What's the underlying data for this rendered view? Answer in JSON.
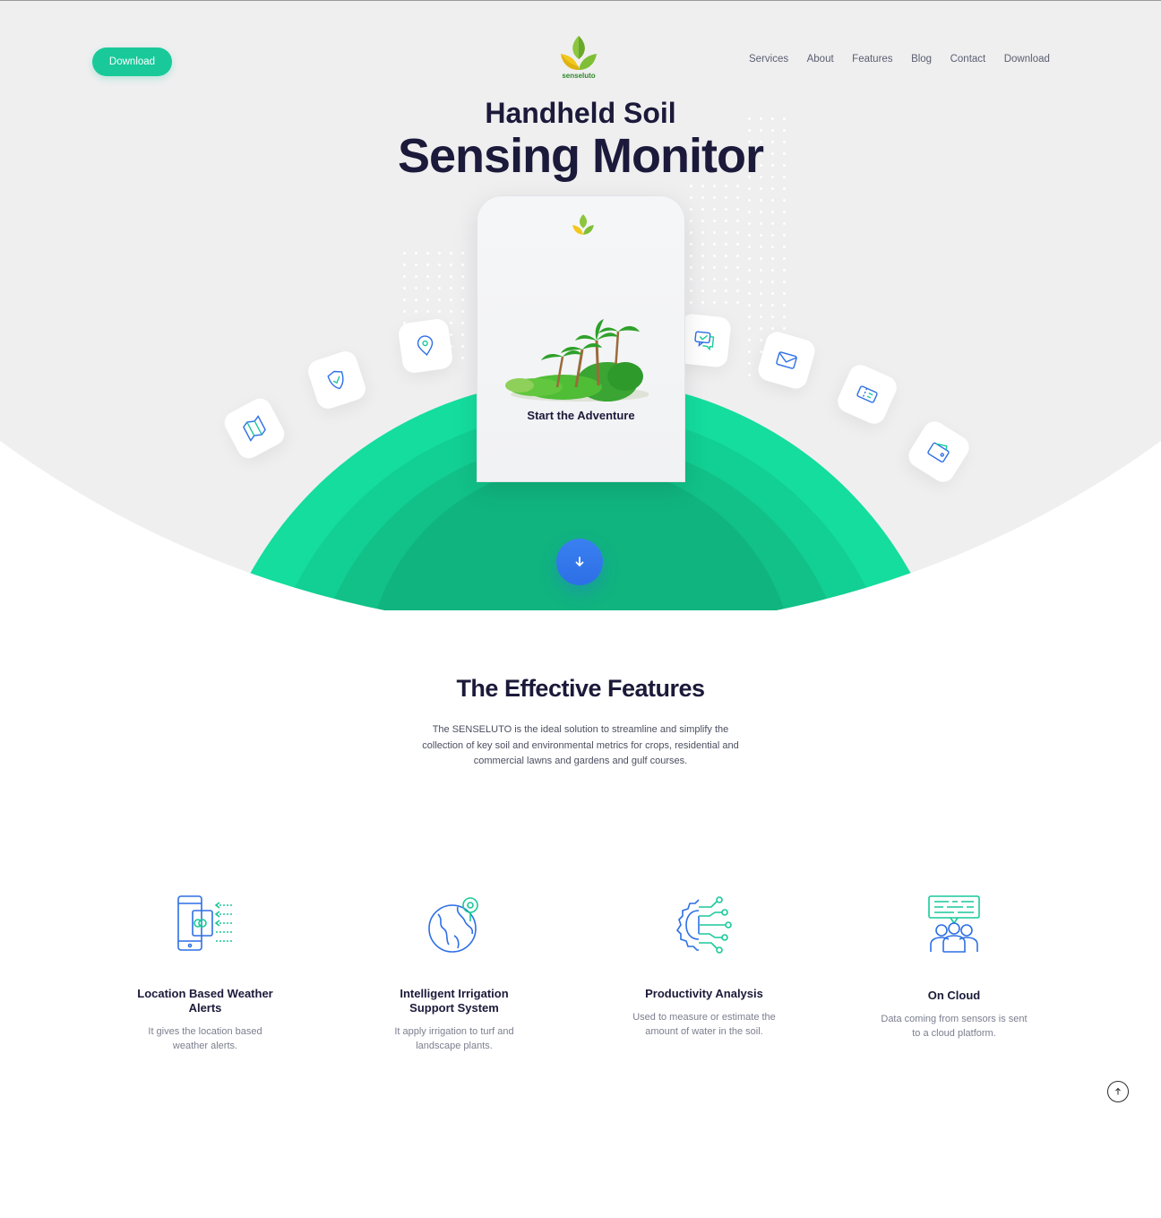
{
  "header": {
    "download_button": "Download",
    "logo_text": "senseluto",
    "nav": [
      "Services",
      "About",
      "Features",
      "Blog",
      "Contact",
      "Download"
    ]
  },
  "hero": {
    "title_line1": "Handheld Soil",
    "title_line2": "Sensing Monitor",
    "phone_caption": "Start the Adventure"
  },
  "features": {
    "title": "The Effective Features",
    "description": "The SENSELUTO is the ideal solution to streamline and simplify the collection of key soil and environmental metrics for crops, residential and commercial lawns and gardens and gulf courses.",
    "items": [
      {
        "name": "Location Based Weather Alerts",
        "desc": "It gives the location based weather alerts.",
        "icon": "mobile-alert-icon"
      },
      {
        "name": "Intelligent Irrigation Support System",
        "desc": "It apply irrigation to turf and landscape plants.",
        "icon": "globe-pin-icon"
      },
      {
        "name": "Productivity Analysis",
        "desc": "Used to  measure or estimate the amount of water in the soil.",
        "icon": "gear-network-icon"
      },
      {
        "name": "On Cloud",
        "desc": "Data coming from sensors is sent to a cloud platform.",
        "icon": "cloud-users-icon"
      }
    ]
  },
  "colors": {
    "accent_green": "#19c99a",
    "arc_green": "#14dd9e",
    "primary_blue": "#2d6fe6",
    "dark_text": "#1b1a3a",
    "hero_bg": "#efeff0"
  }
}
